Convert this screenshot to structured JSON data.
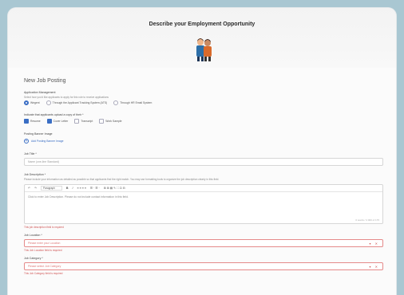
{
  "header": {
    "title": "Describe your Employment Opportunity"
  },
  "form": {
    "heading": "New Job Posting",
    "app_mgmt": {
      "label": "Application Management",
      "help": "Select how you'd like applicants to apply for this role to receive applications",
      "options": [
        {
          "label": "Wegent",
          "selected": true
        },
        {
          "label": "Through the Applicant Tracking System (ATS)",
          "selected": false
        },
        {
          "label": "Through HR Email System",
          "selected": false
        }
      ]
    },
    "docs": {
      "label": "Indicate that applicants upload a copy of their *",
      "options": [
        {
          "label": "Resume",
          "checked": true
        },
        {
          "label": "Cover Letter",
          "checked": true
        },
        {
          "label": "Transcript",
          "checked": false
        },
        {
          "label": "Work Sample",
          "checked": false
        }
      ]
    },
    "banner": {
      "label": "Posting Banner Image",
      "add_label": "Add Posting Banner Image"
    },
    "job_title": {
      "label": "Job Title *",
      "placeholder": "Name (one-line Standard)"
    },
    "description": {
      "label": "Job Description *",
      "help": "Please include your information as detailed as possible so that applicants find the right match. You may use formatting tools to organize the job description clearly in this field.",
      "toolbar": {
        "undo": "↶",
        "redo": "↷",
        "style": "Paragraph",
        "bold": "B",
        "italic": "I",
        "align": "≡ ≡ ≡ ≡",
        "lists": "☰ · ☰ ·",
        "tools": "⊞ ⊞ ▤ ✎ ⛶ ⊡ ⊟"
      },
      "placeholder": "Click to enter Job Description. Please do not include contact information in this field.",
      "counter": "0 words / 4 000 of 175",
      "error": "This job description field is required"
    },
    "location": {
      "label": "Job Location *",
      "placeholder": "Please enter your Location",
      "error": "This Job Location field is required"
    },
    "category": {
      "label": "Job Category *",
      "placeholder": "Please select Job Category",
      "error": "This Job Category field is required"
    }
  },
  "colors": {
    "accent": "#3a6ec4",
    "error": "#d05555",
    "background": "#a9c7d2"
  }
}
